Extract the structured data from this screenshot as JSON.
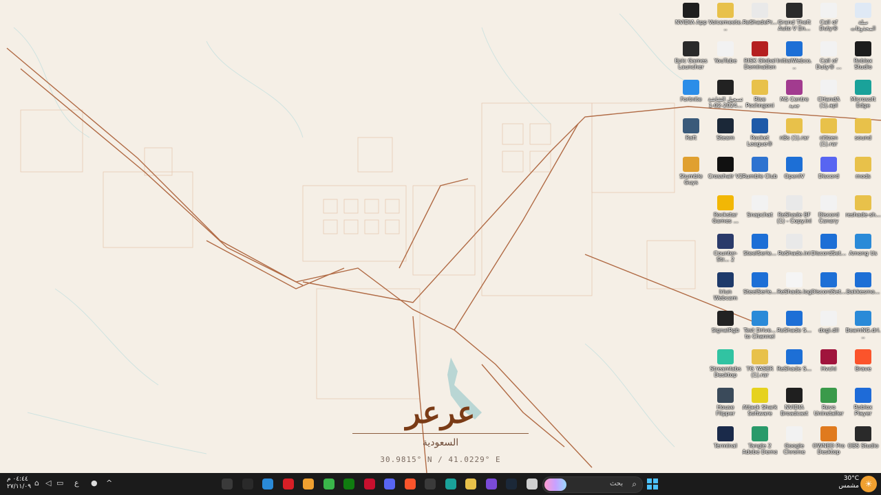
{
  "wallpaper": {
    "city_name": "عرعر",
    "country": "السعودية",
    "coordinates": "30.9815° N / 41.0229° E"
  },
  "desktop_icons": [
    {
      "label": "NVIDIA App",
      "icon": "nvidia-icon",
      "color": "#1f1f1f"
    },
    {
      "label": "Voicemeete...",
      "icon": "folder-icon",
      "color": "#e8c14a"
    },
    {
      "label": "ReShadePr...",
      "icon": "file-icon",
      "color": "#e9e9e9"
    },
    {
      "label": "Grand Theft Auto V En...",
      "icon": "gta-icon",
      "color": "#2b2b2b"
    },
    {
      "label": "Call of Duty®",
      "icon": "file-icon",
      "color": "#f2f2f2"
    },
    {
      "label": "سلة المحذوفات",
      "icon": "recycle-bin-icon",
      "color": "#dfe9f5"
    },
    {
      "label": "Epic Games Launcher",
      "icon": "epic-icon",
      "color": "#2a2a2a"
    },
    {
      "label": "YouTube",
      "icon": "file-icon",
      "color": "#f2f2f2"
    },
    {
      "label": "RISK Global Domination",
      "icon": "risk-icon",
      "color": "#b52020"
    },
    {
      "label": "InitialWebco...",
      "icon": "app-icon",
      "color": "#1d6fd6"
    },
    {
      "label": "Call of Duty® ...",
      "icon": "file-icon",
      "color": "#f2f2f2"
    },
    {
      "label": "Roblox Studio",
      "icon": "roblox-studio-icon",
      "color": "#1c1c1c"
    },
    {
      "label": "Fortnite",
      "icon": "fortnite-icon",
      "color": "#2b8de8"
    },
    {
      "label": "تسجيل الشاشة 2024-02-1...",
      "icon": "video-icon",
      "color": "#222"
    },
    {
      "label": "Rise Pochngoni",
      "icon": "folder-icon",
      "color": "#e8c14a"
    },
    {
      "label": "MS Centre جديد",
      "icon": "ms-centre-icon",
      "color": "#a23b8f"
    },
    {
      "label": "CHandA (1).apl",
      "icon": "file-icon",
      "color": "#f2f2f2"
    },
    {
      "label": "Microsoft Edge",
      "icon": "edge-icon",
      "color": "#1aa29a"
    },
    {
      "label": "Raft",
      "icon": "raft-icon",
      "color": "#3a5a7a"
    },
    {
      "label": "Steam",
      "icon": "steam-icon",
      "color": "#1b2838"
    },
    {
      "label": "Rocket League®",
      "icon": "rocket-league-icon",
      "color": "#1e5aa8"
    },
    {
      "label": "nBs (1).rar",
      "icon": "archive-icon",
      "color": "#e8c14a"
    },
    {
      "label": "citizen (1).rar",
      "icon": "archive-icon",
      "color": "#e8c14a"
    },
    {
      "label": "sound",
      "icon": "folder-icon",
      "color": "#e8c14a"
    },
    {
      "label": "Stumble Guys",
      "icon": "stumble-guys-icon",
      "color": "#e0a030"
    },
    {
      "label": "Crosshair V2",
      "icon": "crosshair-icon",
      "color": "#111"
    },
    {
      "label": "Rumble Club",
      "icon": "rumble-club-icon",
      "color": "#2e73d0"
    },
    {
      "label": "OpenIV",
      "icon": "openiv-icon",
      "color": "#1d6fd6"
    },
    {
      "label": "Discord",
      "icon": "discord-icon",
      "color": "#5865f2"
    },
    {
      "label": "mods",
      "icon": "folder-icon",
      "color": "#e8c14a"
    },
    {
      "label": "Rockstar Games ...",
      "icon": "rockstar-icon",
      "color": "#f2b705"
    },
    {
      "label": "Snapchat",
      "icon": "file-icon",
      "color": "#f2f2f2"
    },
    {
      "label": "ReShade BF (1) - Copy.ini",
      "icon": "file-icon",
      "color": "#e9e9e9"
    },
    {
      "label": "Discord Canary",
      "icon": "file-icon",
      "color": "#f2f2f2"
    },
    {
      "label": "reshade-sh...",
      "icon": "folder-icon",
      "color": "#e8c14a"
    },
    {
      "label": "Counter-Str... 2",
      "icon": "counter-strike-icon",
      "color": "#2a3a6a"
    },
    {
      "label": "SteelSerie...",
      "icon": "app-icon",
      "color": "#1d6fd6"
    },
    {
      "label": "ReShade.ini",
      "icon": "file-icon",
      "color": "#e9e9e9"
    },
    {
      "label": "DiscordSet...",
      "icon": "app-icon",
      "color": "#1d6fd6"
    },
    {
      "label": "Among Us",
      "icon": "globe-icon",
      "color": "#2a8ad8"
    },
    {
      "label": "Iriun Webcam",
      "icon": "webcam-icon",
      "color": "#1e3a6a"
    },
    {
      "label": "SteelSerie...",
      "icon": "app-icon",
      "color": "#1d6fd6"
    },
    {
      "label": "ReShade.log",
      "icon": "file-icon",
      "color": "#f5f5f5"
    },
    {
      "label": "DiscordSet...",
      "icon": "app-icon",
      "color": "#1d6fd6"
    },
    {
      "label": "Bakkesmo...",
      "icon": "app-icon",
      "color": "#1d6fd6"
    },
    {
      "label": "SignalRgb",
      "icon": "signalrgb-icon",
      "color": "#222"
    },
    {
      "label": "Test Drive... to Channel",
      "icon": "globe-icon",
      "color": "#2a8ad8"
    },
    {
      "label": "ReShade S...",
      "icon": "app-icon",
      "color": "#1d6fd6"
    },
    {
      "label": "dxgi.dll",
      "icon": "file-icon",
      "color": "#f2f2f2"
    },
    {
      "label": "BeamNG.dri...",
      "icon": "globe-icon",
      "color": "#2a8ad8"
    },
    {
      "label": "Streamlabs Desktop",
      "icon": "streamlabs-icon",
      "color": "#31c3a2"
    },
    {
      "label": "TG YASER (1).rar",
      "icon": "archive-icon",
      "color": "#e8c14a"
    },
    {
      "label": "ReShade S...",
      "icon": "app-icon",
      "color": "#1d6fd6"
    },
    {
      "label": "Hvchi",
      "icon": "hvchi-icon",
      "color": "#a0143c"
    },
    {
      "label": "Brave",
      "icon": "brave-icon",
      "color": "#fb542b"
    },
    {
      "label": "House Flipper",
      "icon": "house-flipper-icon",
      "color": "#3a4a5a"
    },
    {
      "label": "Attack Shark Software",
      "icon": "attack-shark-icon",
      "color": "#e6d21e"
    },
    {
      "label": "NVIDIA Broadcast",
      "icon": "nvidia-icon",
      "color": "#1f1f1f"
    },
    {
      "label": "Revo Uninstaller",
      "icon": "revo-icon",
      "color": "#3a9a4a"
    },
    {
      "label": "Roblox Player",
      "icon": "roblox-icon",
      "color": "#1e6bd8"
    },
    {
      "label": "Terminal",
      "icon": "terminal-icon",
      "color": "#1a2a4a"
    },
    {
      "label": "Tangle 2 Adobe Demo",
      "icon": "tangle-icon",
      "color": "#2a9a6a"
    },
    {
      "label": "Google Chrome",
      "icon": "chrome-icon",
      "color": "#f2f2f2"
    },
    {
      "label": "OWNED Pro Desktop",
      "icon": "owned-icon",
      "color": "#e07a1e"
    },
    {
      "label": "OBS Studio",
      "icon": "obs-icon",
      "color": "#2a2a2a"
    }
  ],
  "taskbar": {
    "clock_time": "٠٤:٤٤ م",
    "clock_date": "٢٧/١١/٠٩",
    "lang": "ع",
    "search_placeholder": "بحث",
    "weather_temp": "30°C",
    "weather_desc": "مشمس",
    "apps": [
      "obs-icon",
      "app-icon",
      "flame-icon",
      "netflix-icon",
      "pen-icon",
      "play-icon",
      "xbox-icon",
      "adobe-icon",
      "discord-icon",
      "brave-icon",
      "store-icon",
      "edge-icon",
      "files-icon",
      "m365-icon",
      "steam-icon",
      "window-icon"
    ]
  }
}
